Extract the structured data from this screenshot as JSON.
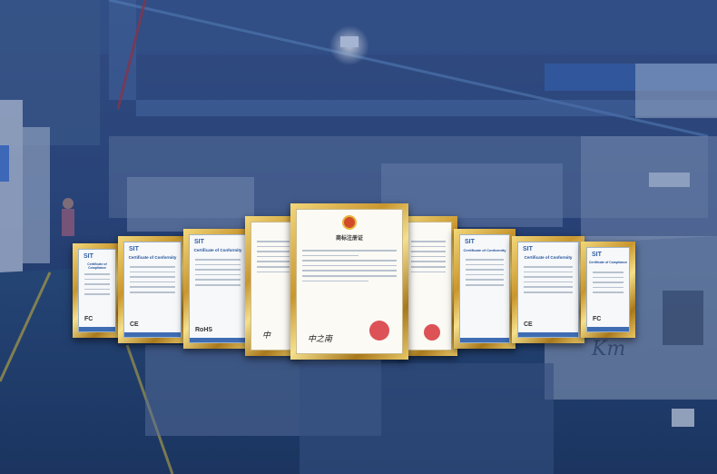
{
  "scene": {
    "description_colors": {
      "overlay": "#1b3a78",
      "frame_gold": "#d4a845"
    }
  },
  "certificates": [
    {
      "brand": "SIT",
      "title": "Certificate of Compliance",
      "mark": "FC"
    },
    {
      "brand": "SIT",
      "title": "Certificate of Conformity",
      "mark": "CE"
    },
    {
      "brand": "SIT",
      "title": "Certificate of Conformity",
      "mark": "RoHS"
    },
    {
      "brand": "",
      "title": "",
      "mark": ""
    },
    {
      "brand": "",
      "title": "商标注册证",
      "mark": ""
    },
    {
      "brand": "",
      "title": "",
      "mark": ""
    },
    {
      "brand": "SIT",
      "title": "Certificate of Conformity",
      "mark": ""
    },
    {
      "brand": "SIT",
      "title": "Certificate of Conformity",
      "mark": "CE"
    },
    {
      "brand": "SIT",
      "title": "Certificate of Compliance",
      "mark": "FC"
    }
  ],
  "background_text": {
    "machine_label": "Km"
  }
}
